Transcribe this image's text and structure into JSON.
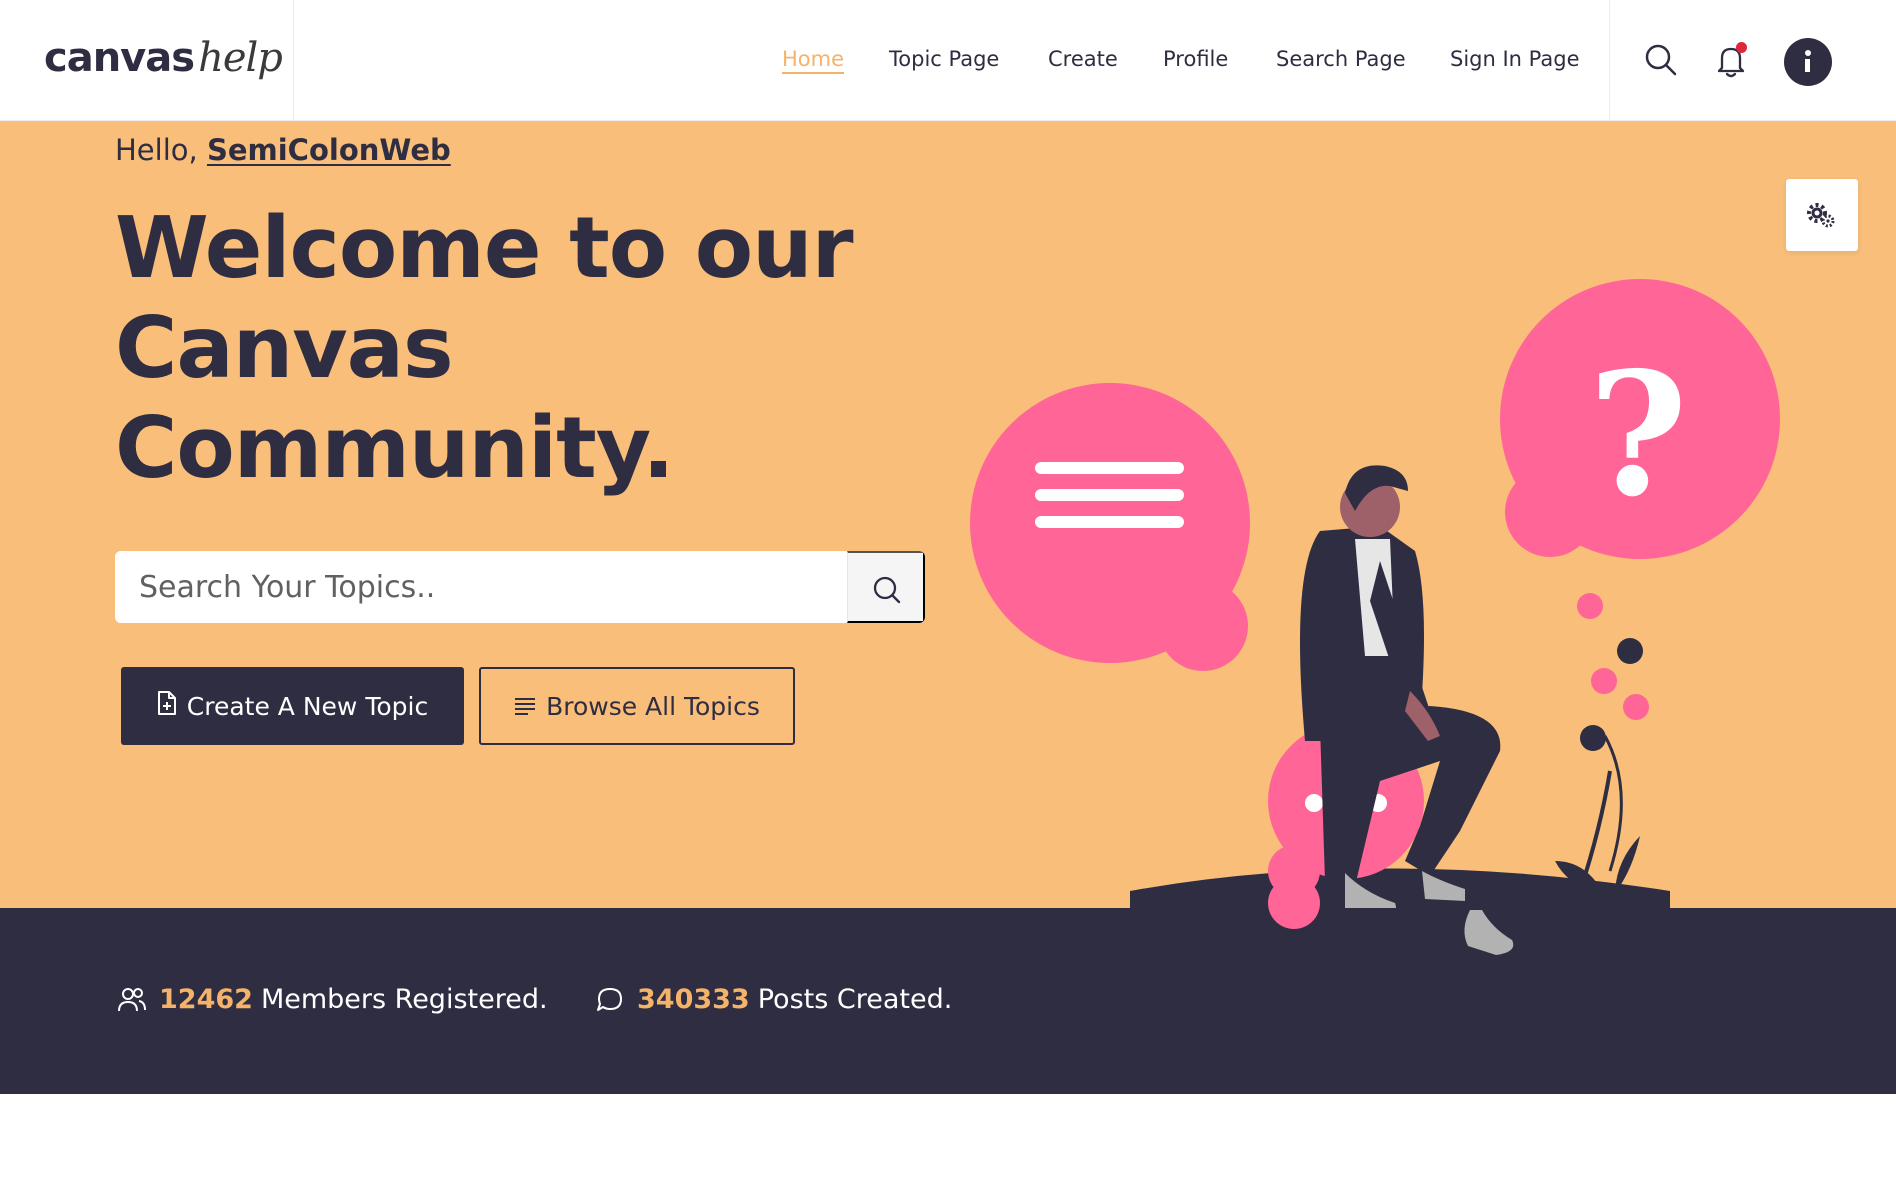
{
  "brand": {
    "logo_bold": "canvas",
    "logo_light": "help"
  },
  "nav": {
    "items": [
      {
        "label": "Home",
        "active": true
      },
      {
        "label": "Topic Page",
        "active": false
      },
      {
        "label": "Create",
        "active": false
      },
      {
        "label": "Profile",
        "active": false
      },
      {
        "label": "Search Page",
        "active": false
      },
      {
        "label": "Sign In Page",
        "active": false
      }
    ],
    "icons": [
      "search-icon",
      "bell-icon",
      "info-icon"
    ]
  },
  "hero": {
    "greeting": "Hello, ",
    "username": "SemiColonWeb",
    "headline": "Welcome to our Canvas Community.",
    "search_placeholder": "Search Your Topics..",
    "search_value": "",
    "buttons": {
      "create": "Create A New Topic",
      "browse": "Browse All Topics"
    }
  },
  "stats": {
    "members_count": "12462",
    "members_label": "Members Registered.",
    "posts_count": "340333",
    "posts_label": "Posts Created."
  },
  "colors": {
    "accent": "#f8be7a",
    "accent_text": "#f5b36a",
    "dark": "#2f2d41",
    "pink": "#ff6596",
    "notification": "#e1263b"
  }
}
